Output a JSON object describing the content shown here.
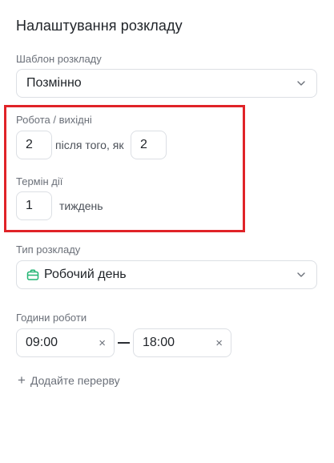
{
  "panel": {
    "title": "Налаштування розкладу"
  },
  "template": {
    "label": "Шаблон розкладу",
    "value": "Позмінно",
    "icon": "chevron-down-icon"
  },
  "work_off": {
    "label": "Робота / вихідні",
    "work_days": "2",
    "connector": "після того, як",
    "off_days": "2"
  },
  "validity": {
    "label": "Термін дії",
    "value": "1",
    "unit": "тиждень"
  },
  "schedule_type": {
    "label": "Тип розкладу",
    "value": "Робочий день",
    "icon": "briefcase-icon",
    "icon_color": "#22b573"
  },
  "work_hours": {
    "label": "Години роботи",
    "start": "09:00",
    "end": "18:00",
    "clear_symbol": "×"
  },
  "add_break": {
    "symbol": "+",
    "label": "Додайте перерву"
  },
  "colors": {
    "highlight": "#e02328",
    "border": "#dcdfe4",
    "muted": "#6b7079"
  }
}
